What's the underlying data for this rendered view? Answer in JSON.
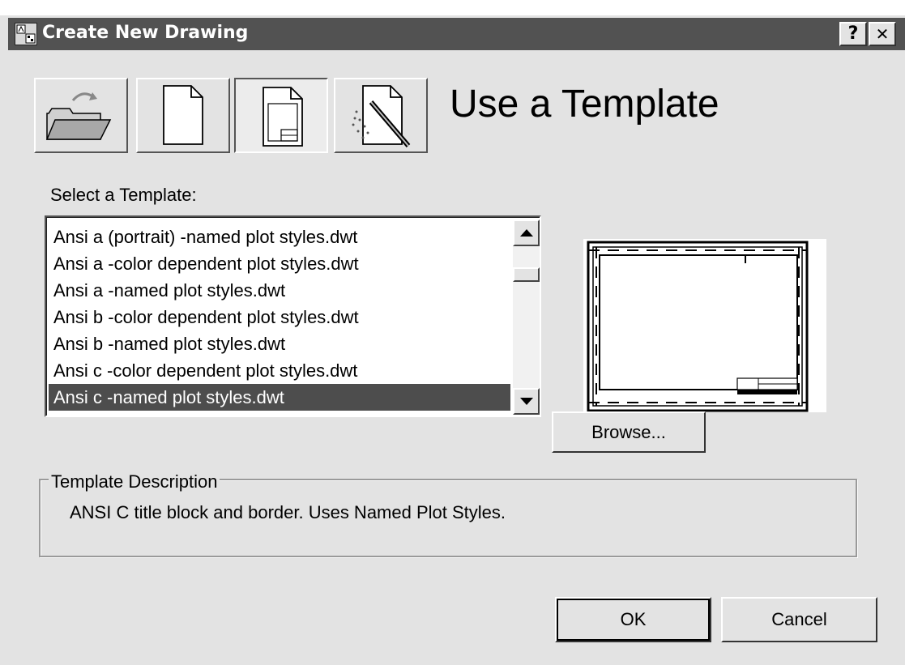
{
  "window": {
    "title": "Create New Drawing",
    "help_label": "?",
    "close_label": "✕"
  },
  "mode_buttons": [
    {
      "name": "open-drawing",
      "icon": "open-folder-icon",
      "pressed": false
    },
    {
      "name": "start-from-scratch",
      "icon": "blank-page-icon",
      "pressed": false
    },
    {
      "name": "use-template",
      "icon": "template-page-icon",
      "pressed": true
    },
    {
      "name": "use-wizard",
      "icon": "wizard-page-icon",
      "pressed": false
    }
  ],
  "heading": "Use a Template",
  "select_label": "Select a Template:",
  "templates": {
    "items": [
      "Ansi a (portrait) -named plot styles.dwt",
      "Ansi a -color dependent plot styles.dwt",
      "Ansi a -named plot styles.dwt",
      "Ansi b -color dependent plot styles.dwt",
      "Ansi b -named plot styles.dwt",
      "Ansi c -color dependent plot styles.dwt",
      "Ansi c -named plot styles.dwt"
    ],
    "selected": "Ansi c -named plot styles.dwt"
  },
  "browse_label": "Browse...",
  "description": {
    "legend": "Template Description",
    "text": "ANSI C title block and border. Uses Named Plot Styles."
  },
  "ok_label": "OK",
  "cancel_label": "Cancel",
  "colors": {
    "dialog_bg": "#e3e3e3",
    "titlebar_bg": "#525252",
    "selection_bg": "#4d4d4d"
  }
}
